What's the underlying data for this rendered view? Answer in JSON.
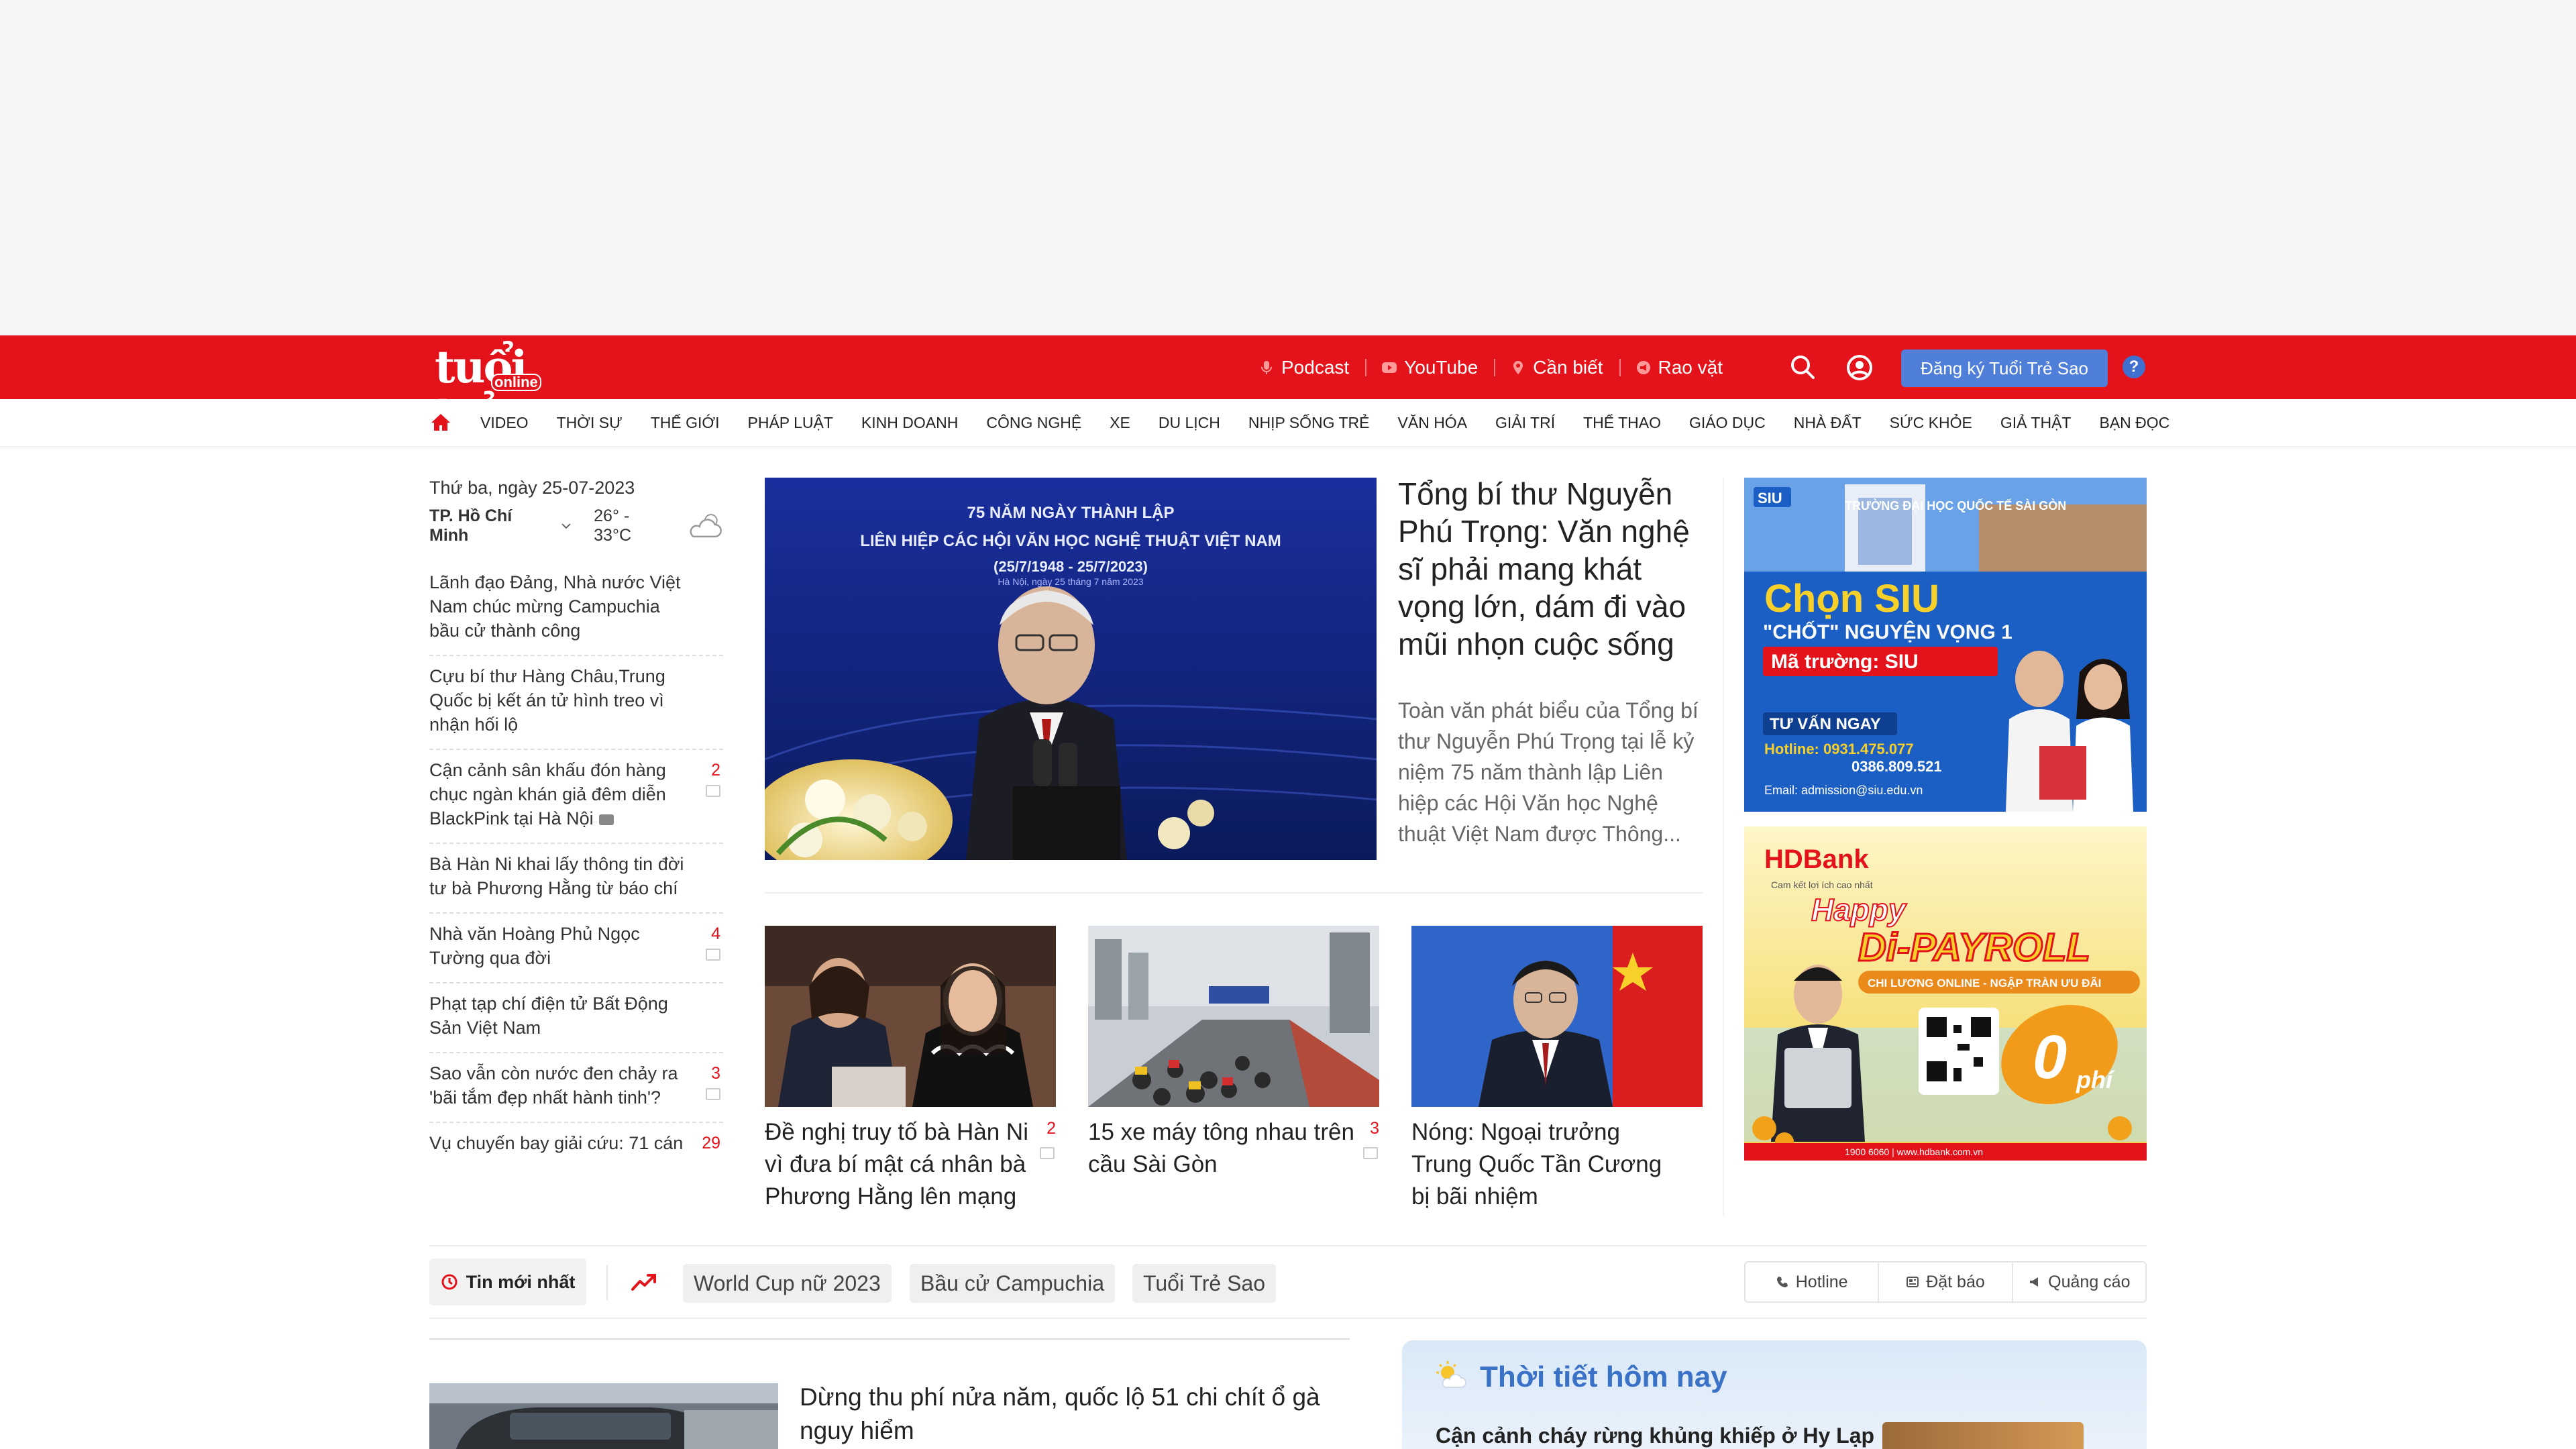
{
  "header": {
    "logo_text": "tuổi trẻ",
    "logo_sub": "online",
    "links": [
      {
        "label": "Podcast",
        "icon": "microphone-icon"
      },
      {
        "label": "YouTube",
        "icon": "youtube-icon"
      },
      {
        "label": "Cần biết",
        "icon": "location-pin-icon"
      },
      {
        "label": "Rao vặt",
        "icon": "megaphone-icon"
      }
    ],
    "signup_label": "Đăng ký Tuổi Trẻ Sao",
    "help_label": "?",
    "accent_color": "#e4131b"
  },
  "nav": {
    "categories": [
      "VIDEO",
      "THỜI SỰ",
      "THẾ GIỚI",
      "PHÁP LUẬT",
      "KINH DOANH",
      "CÔNG NGHỆ",
      "XE",
      "DU LỊCH",
      "NHỊP SỐNG TRẺ",
      "VĂN HÓA",
      "GIẢI TRÍ",
      "THỂ THAO",
      "GIÁO DỤC",
      "NHÀ ĐẤT",
      "SỨC KHỎE",
      "GIẢ THẬT",
      "BẠN ĐỌC"
    ]
  },
  "sidebar": {
    "date": "Thứ ba, ngày 25-07-2023",
    "city": "TP. Hồ Chí Minh",
    "temp": "26° - 33°C",
    "items": [
      {
        "title": "Lãnh đạo Đảng, Nhà nước Việt Nam chúc mừng Campuchia bầu cử thành công",
        "count": ""
      },
      {
        "title": "Cựu bí thư Hàng Châu,Trung Quốc bị kết án tử hình treo vì nhận hối lộ",
        "count": ""
      },
      {
        "title": "Cận cảnh sân khấu đón hàng chục ngàn khán giả đêm diễn BlackPink tại Hà Nội",
        "count": "2"
      },
      {
        "title": "Bà Hàn Ni khai lấy thông tin đời tư bà Phương Hằng từ báo chí",
        "count": ""
      },
      {
        "title": "Nhà văn Hoàng Phủ Ngọc Tường qua đời",
        "count": "4"
      },
      {
        "title": "Phạt tạp chí điện tử Bất Động Sản Việt Nam",
        "count": ""
      },
      {
        "title": "Sao vẫn còn nước đen chảy ra 'bãi tắm đẹp nhất hành tinh'?",
        "count": "3"
      },
      {
        "title": "Vụ chuyến bay giải cứu: 71 cán",
        "count": "29"
      }
    ]
  },
  "featured": {
    "title": "Tổng bí thư Nguyễn Phú Trọng: Văn nghệ sĩ phải mang khát vọng lớn, dám đi vào mũi nhọn cuộc sống",
    "desc": "Toàn văn phát biểu của Tổng bí thư Nguyễn Phú Trọng tại lễ kỷ niệm 75 năm thành lập Liên hiệp các Hội Văn học Nghệ thuật Việt Nam được Thông...",
    "banner_line1": "75 NĂM NGÀY THÀNH LẬP",
    "banner_line2": "LIÊN HIỆP CÁC HỘI VĂN HỌC NGHỆ THUẬT VIỆT NAM",
    "banner_line3": "(25/7/1948 - 25/7/2023)",
    "banner_line4": "Hà Nội, ngày 25 tháng 7 năm 2023"
  },
  "sub_stories": [
    {
      "title": "Đề nghị truy tố bà Hàn Ni vì đưa bí mật cá nhân bà Phương Hằng lên mạng",
      "count": "2"
    },
    {
      "title": "15 xe máy tông nhau trên cầu Sài Gòn",
      "count": "3"
    },
    {
      "title": "Nóng: Ngoại trưởng Trung Quốc Tần Cương bị bãi nhiệm",
      "count": ""
    }
  ],
  "ads": {
    "siu": {
      "brand": "SIU",
      "school": "TRƯỜNG ĐẠI HỌC QUỐC TẾ SÀI GÒN",
      "headline": "Chọn SIU",
      "sub": "\"CHỐT\" NGUYỆN VỌNG 1",
      "code": "Mã trường: SIU",
      "consult": "TƯ VẤN NGAY",
      "hotline": "Hotline: 0931.475.077",
      "phone2": "0386.809.521",
      "email": "Email: admission@siu.edu.vn"
    },
    "hdbank": {
      "brand": "HDBank",
      "slogan": "Cam kết lợi ích cao nhất",
      "happy": "Happy",
      "payroll": "Di-PAYROLL",
      "sub": "CHI LƯƠNG ONLINE - NGẬP TRÀN ƯU ĐÃI",
      "zero": "0",
      "phi": "phí",
      "footer": "1900 6060 | www.hdbank.com.vn"
    }
  },
  "trending": {
    "newest_label": "Tin mới nhất",
    "tags": [
      "World Cup nữ 2023",
      "Bầu cử Campuchia",
      "Tuổi Trẻ Sao"
    ],
    "utils": [
      {
        "label": "Hotline",
        "icon": "phone-icon"
      },
      {
        "label": "Đặt báo",
        "icon": "newspaper-icon"
      },
      {
        "label": "Quảng cáo",
        "icon": "megaphone-icon"
      }
    ]
  },
  "bottom": {
    "story_title": "Dừng thu phí nửa năm, quốc lộ 51 chi chít ổ gà nguy hiểm",
    "weather_title": "Thời tiết hôm nay",
    "weather_story": "Cận cảnh cháy rừng khủng khiếp ở Hy Lạp"
  }
}
